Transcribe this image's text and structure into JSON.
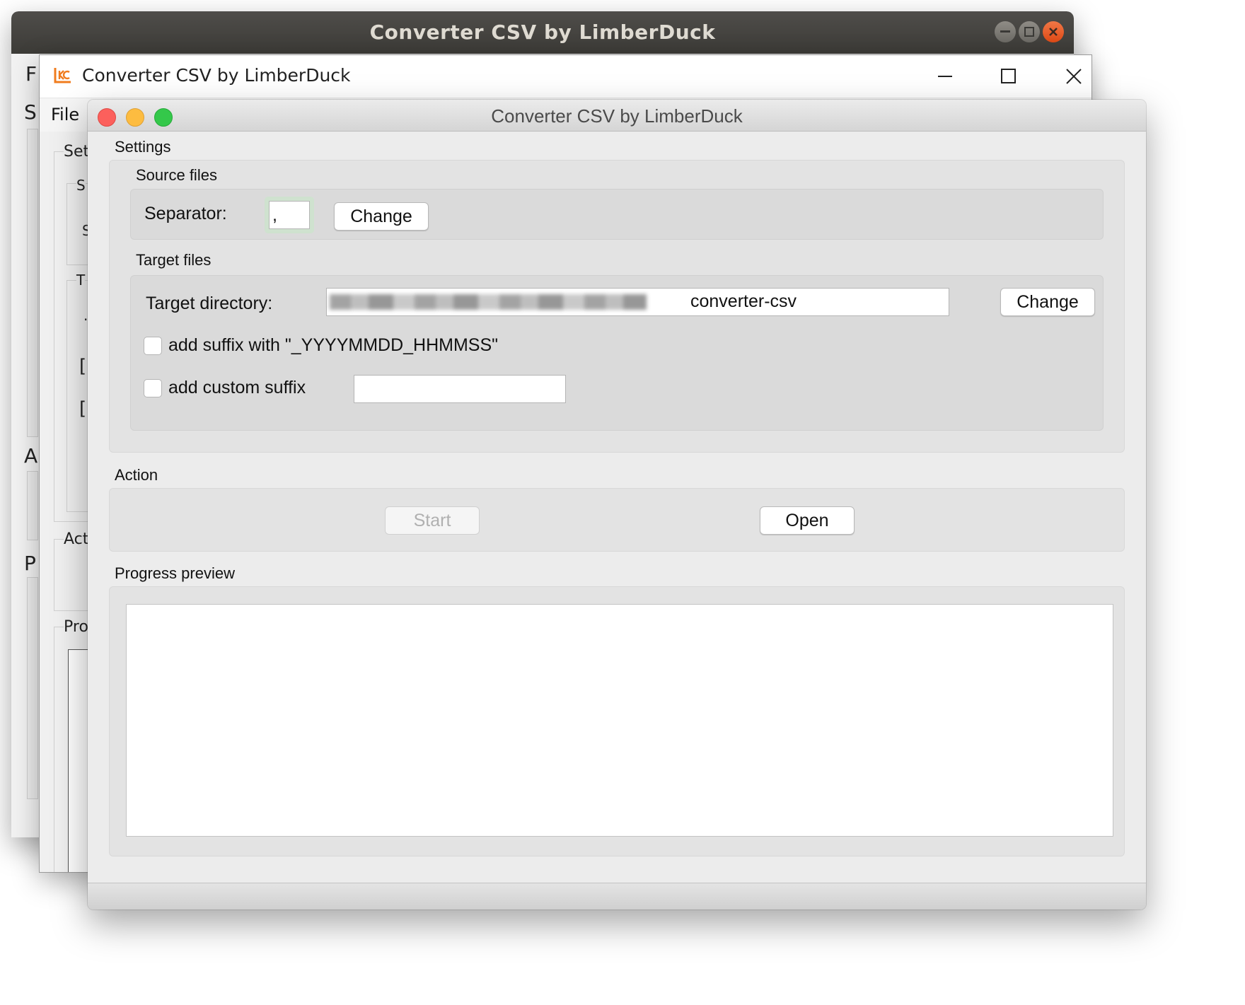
{
  "ubuntu_window": {
    "title": "Converter CSV by LimberDuck",
    "menu_fragment": "F",
    "fragments": [
      "S",
      "A",
      "P"
    ]
  },
  "windows_window": {
    "title": "Converter CSV by LimberDuck",
    "menu_file": "File",
    "fragments": {
      "settings": "Set",
      "source": "S",
      "separator": "S",
      "target": "T",
      "dot": ".",
      "check1": "[",
      "check2": "[",
      "action": "Act",
      "progress": "Pro"
    }
  },
  "mac_window": {
    "title": "Converter CSV by LimberDuck",
    "settings": {
      "title": "Settings",
      "source_files": {
        "title": "Source files",
        "separator_label": "Separator:",
        "separator_value": ",",
        "change_label": "Change"
      },
      "target_files": {
        "title": "Target files",
        "directory_label": "Target directory:",
        "directory_value": "converter-csv",
        "change_label": "Change",
        "suffix_datetime_label": "add suffix with \"_YYYYMMDD_HHMMSS\"",
        "suffix_datetime_checked": false,
        "custom_suffix_label": "add custom suffix",
        "custom_suffix_checked": false,
        "custom_suffix_value": ""
      }
    },
    "action": {
      "title": "Action",
      "start_label": "Start",
      "start_enabled": false,
      "open_label": "Open"
    },
    "progress": {
      "title": "Progress preview",
      "log_text": ""
    }
  },
  "colors": {
    "mac_close": "#fc605c",
    "mac_minimize": "#fdbc40",
    "mac_zoom": "#34c84a",
    "ubuntu_close": "#e95420",
    "app_icon": "#f07c1e"
  }
}
